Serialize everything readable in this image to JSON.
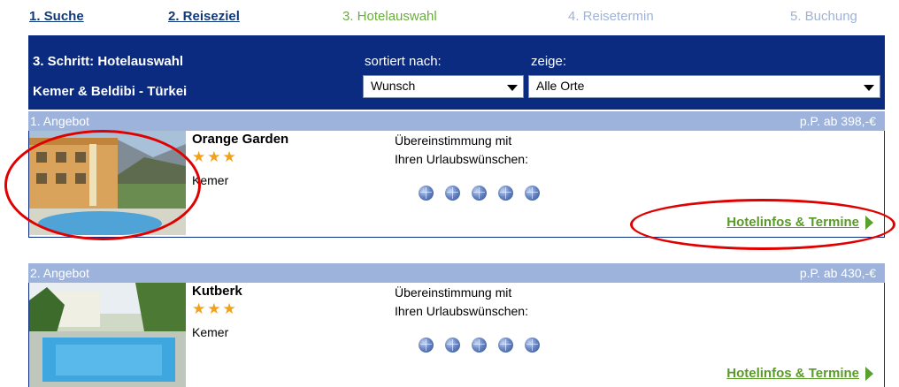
{
  "steps": [
    {
      "label": "1. Suche",
      "state": "done"
    },
    {
      "label": "2. Reiseziel",
      "state": "done"
    },
    {
      "label": "3. Hotelauswahl",
      "state": "current"
    },
    {
      "label": "4. Reisetermin",
      "state": "future"
    },
    {
      "label": "5. Buchung",
      "state": "future"
    }
  ],
  "header": {
    "step_title": "3. Schritt: Hotelauswahl",
    "region": "Kemer & Beldibi - Türkei",
    "sort_label": "sortiert nach:",
    "sort_value": "Wunsch",
    "show_label": "zeige:",
    "show_value": "Alle Orte"
  },
  "offers": [
    {
      "number": "1. Angebot",
      "price": "p.P. ab 398,-€",
      "hotel": "Orange Garden",
      "stars": "★★★",
      "star_count": 3,
      "location": "Kemer",
      "match_line1": "Übereinstimmung mit",
      "match_line2": "Ihren Urlaubswünschen:",
      "globe_count": 5,
      "link": "Hotelinfos & Termine"
    },
    {
      "number": "2. Angebot",
      "price": "p.P. ab 430,-€",
      "hotel": "Kutberk",
      "stars": "★★★",
      "star_count": 3,
      "location": "Kemer",
      "match_line1": "Übereinstimmung mit",
      "match_line2": "Ihren Urlaubswünschen:",
      "globe_count": 5,
      "link": "Hotelinfos & Termine"
    }
  ],
  "colors": {
    "header_bg": "#0b2b80",
    "offer_bar": "#9db3db",
    "link_green": "#5a9a28",
    "annotation_red": "#e00000"
  }
}
